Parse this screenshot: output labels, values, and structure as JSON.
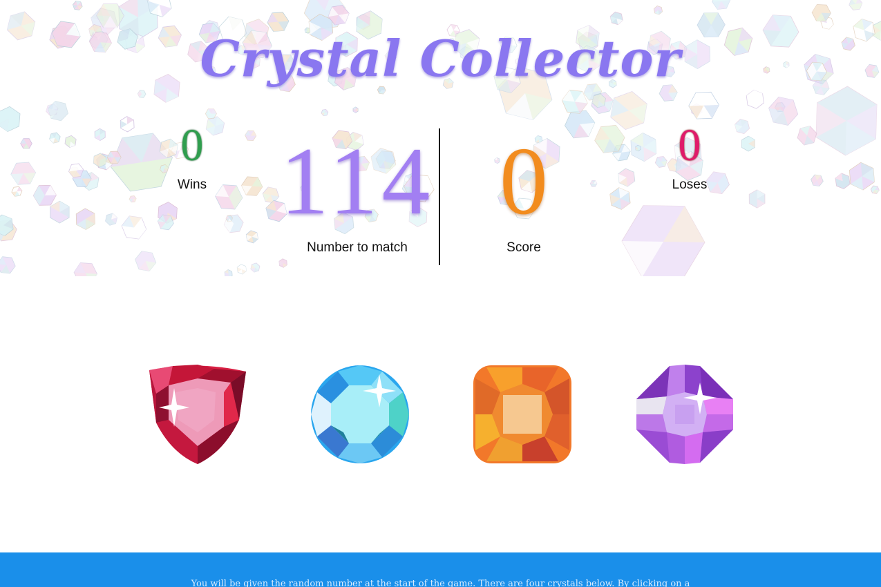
{
  "header": {
    "title": "Crystal Collector"
  },
  "stats": {
    "wins_value": "0",
    "wins_label": "Wins",
    "target_value": "114",
    "target_label": "Number to match",
    "score_value": "0",
    "score_label": "Score",
    "loses_value": "0",
    "loses_label": "Loses"
  },
  "crystals": [
    {
      "name": "red-trillion",
      "icon": "red-gem-icon",
      "color": "#e0284a"
    },
    {
      "name": "blue-round",
      "icon": "blue-gem-icon",
      "color": "#3aa8f0"
    },
    {
      "name": "orange-cushion",
      "icon": "orange-gem-icon",
      "color": "#f07a24"
    },
    {
      "name": "purple-octagon",
      "icon": "purple-gem-icon",
      "color": "#a054e0"
    }
  ],
  "footer": {
    "instructions": "You will be given the random number at the start of the game. There are four crystals below. By clicking on a"
  },
  "colors": {
    "title": "#8a77f0",
    "wins": "#2f9e4e",
    "target": "#a27ff2",
    "score": "#f28c1e",
    "loses": "#e01a6a",
    "footer_bg": "#1a8fea"
  }
}
